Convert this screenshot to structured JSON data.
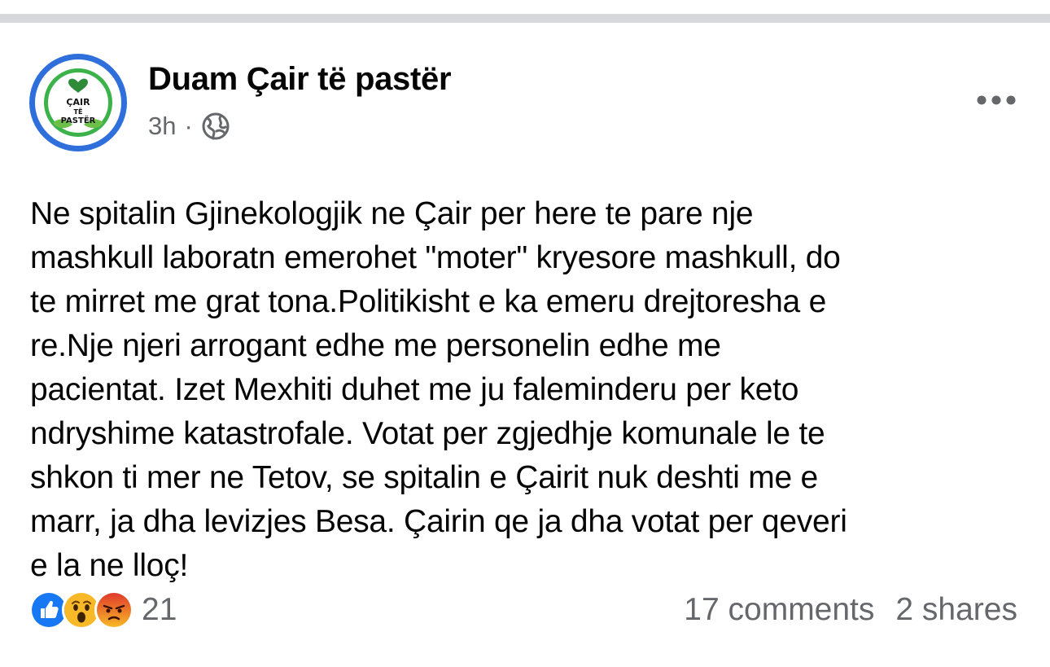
{
  "post": {
    "page_name": "Duam Çair të pastër",
    "time": "3h",
    "separator": "·",
    "privacy_icon": "globe-icon",
    "more_icon": "more-options-icon",
    "avatar_logo_text": [
      "ÇAIR",
      "TË",
      "PASTËR"
    ],
    "body_lines": [
      "Ne spitalin Gjinekologjik ne Çair per here te pare nje",
      "mashkull laboratn emerohet \"moter\" kryesore mashkull, do",
      "te mirret me grat tona.Politikisht e ka emeru drejtoresha e",
      "re.Nje njeri arrogant edhe me personelin edhe me",
      "pacientat. Izet Mexhiti duhet me ju faleminderu per keto",
      "ndryshime katastrofale. Votat per zgjedhje komunale le te",
      "shkon ti mer ne Tetov, se spitalin e Çairit nuk deshti me e",
      "marr, ja dha levizjes Besa. Çairin qe ja dha votat per qeveri",
      "e la ne lloç!"
    ]
  },
  "engagement": {
    "reactions": [
      "like-icon",
      "wow-icon",
      "angry-icon"
    ],
    "reaction_count": "21",
    "comments": "17 comments",
    "shares": "2 shares"
  },
  "colors": {
    "like": "#1877f2",
    "wow": "#f7b928",
    "angry": "#e9710f",
    "secondary_text": "#65676b",
    "divider": "#d6d8dc",
    "avatar_ring": "#2f6fdc",
    "logo_green": "#3cb34a"
  }
}
